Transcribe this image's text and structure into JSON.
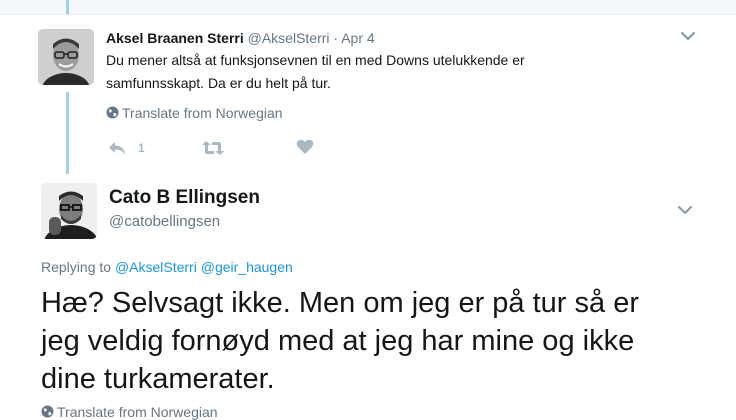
{
  "reply_tweet": {
    "author_name": "Aksel Braanen Sterri",
    "handle": "@AkselSterri",
    "separator": "·",
    "date": "Apr 4",
    "text_line1": "Du mener altså at funksjonsevnen til en med Downs utelukkende er",
    "text_line2": "samfunnsskapt. Da er du helt på tur.",
    "translate_label": "Translate from Norwegian",
    "reply_count": "1",
    "icons": [
      "reply-icon",
      "retweet-icon",
      "like-icon",
      "chevron-down-icon",
      "globe-icon"
    ]
  },
  "main_tweet": {
    "author_name": "Cato B Ellingsen",
    "handle": "@catobellingsen",
    "replying_prefix": "Replying to",
    "replying_to_1": "@AkselSterri",
    "replying_to_2": "@geir_haugen",
    "text_line1": "Hæ? Selvsagt ikke. Men om jeg er på tur så er",
    "text_line2": "jeg veldig fornøyd med at jeg har mine og ikke",
    "text_line3": "dine turkamerater.",
    "translate_label": "Translate from Norwegian",
    "icons": [
      "chevron-down-icon",
      "globe-icon"
    ]
  },
  "colors": {
    "link": "#1b95e0",
    "muted": "#657786",
    "thread_line": "#9fd0ee",
    "text": "#14171a"
  }
}
